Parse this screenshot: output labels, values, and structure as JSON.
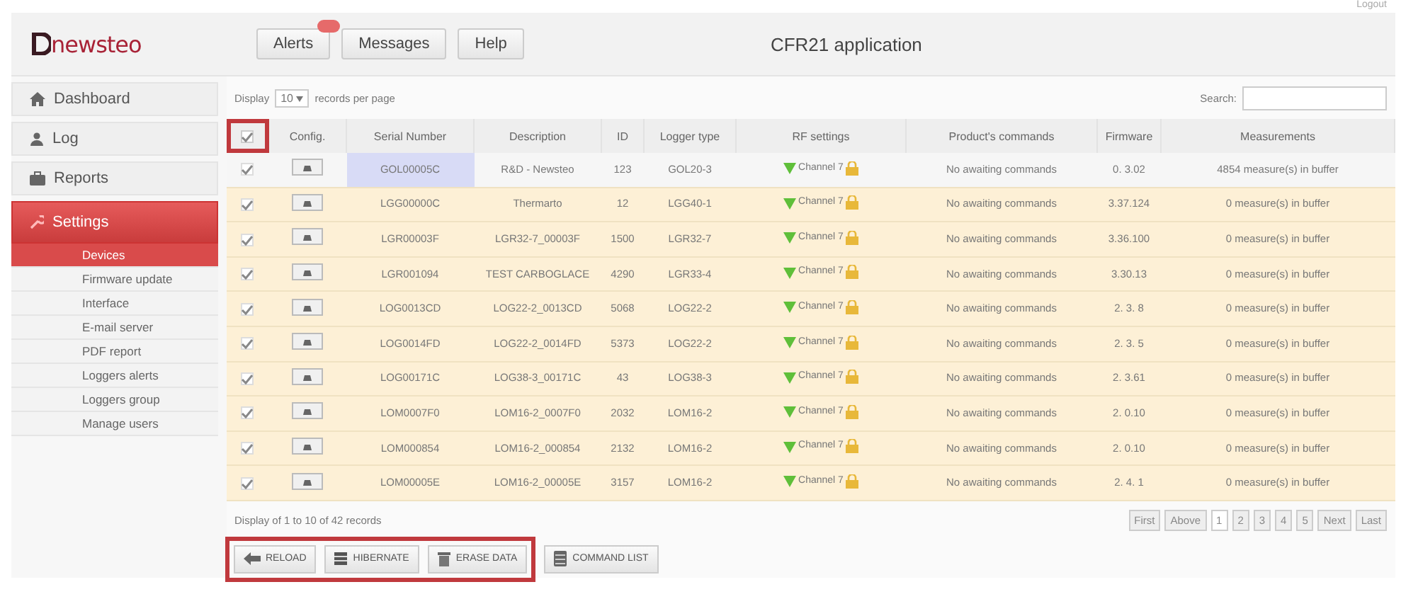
{
  "top_bar": {
    "logout": "Logout"
  },
  "logo": {
    "text": "newsteo"
  },
  "header": {
    "buttons": [
      {
        "label": "Alerts",
        "badge": true
      },
      {
        "label": "Messages",
        "badge": false
      },
      {
        "label": "Help",
        "badge": false
      }
    ],
    "title": "CFR21 application"
  },
  "sidebar": {
    "items": [
      {
        "label": "Dashboard",
        "selected": false
      },
      {
        "label": "Log",
        "selected": false
      },
      {
        "label": "Reports",
        "selected": false
      },
      {
        "label": "Settings",
        "selected": true,
        "children": [
          {
            "label": "Devices",
            "selected": true
          },
          {
            "label": "Firmware update",
            "selected": false
          },
          {
            "label": "Interface",
            "selected": false
          },
          {
            "label": "E-mail server",
            "selected": false
          },
          {
            "label": "PDF report",
            "selected": false
          },
          {
            "label": "Loggers alerts",
            "selected": false
          },
          {
            "label": "Loggers group",
            "selected": false
          },
          {
            "label": "Manage users",
            "selected": false
          }
        ]
      }
    ]
  },
  "table_controls": {
    "display_label": "Display",
    "page_size": "10",
    "page_size_suffix": "records per page",
    "search_label": "Search:"
  },
  "table": {
    "select_all": {
      "checked": true,
      "highlighted": true
    },
    "columns": [
      "Config.",
      "Serial Number",
      "Description",
      "ID",
      "Logger type",
      "RF settings",
      "Product's commands",
      "Firmware",
      "Measurements"
    ],
    "rows": [
      {
        "checked": true,
        "current": true,
        "serial": "GOL00005C",
        "description": "R&D - Newsteo",
        "id": "123",
        "logger_type": "GOL20-3",
        "rf": "Channel 7",
        "commands": "No awaiting commands",
        "firmware": "0. 3.02",
        "measurements": "4854 measure(s) in buffer"
      },
      {
        "checked": true,
        "current": false,
        "serial": "LGG00000C",
        "description": "Thermarto",
        "id": "12",
        "logger_type": "LGG40-1",
        "rf": "Channel 7",
        "commands": "No awaiting commands",
        "firmware": "3.37.124",
        "measurements": "0 measure(s) in buffer"
      },
      {
        "checked": true,
        "current": false,
        "serial": "LGR00003F",
        "description": "LGR32-7_00003F",
        "id": "1500",
        "logger_type": "LGR32-7",
        "rf": "Channel 7",
        "commands": "No awaiting commands",
        "firmware": "3.36.100",
        "measurements": "0 measure(s) in buffer"
      },
      {
        "checked": true,
        "current": false,
        "serial": "LGR001094",
        "description": "TEST CARBOGLACE",
        "id": "4290",
        "logger_type": "LGR33-4",
        "rf": "Channel 7",
        "commands": "No awaiting commands",
        "firmware": "3.30.13",
        "measurements": "0 measure(s) in buffer"
      },
      {
        "checked": true,
        "current": false,
        "serial": "LOG0013CD",
        "description": "LOG22-2_0013CD",
        "id": "5068",
        "logger_type": "LOG22-2",
        "rf": "Channel 7",
        "commands": "No awaiting commands",
        "firmware": "2. 3. 8",
        "measurements": "0 measure(s) in buffer"
      },
      {
        "checked": true,
        "current": false,
        "serial": "LOG0014FD",
        "description": "LOG22-2_0014FD",
        "id": "5373",
        "logger_type": "LOG22-2",
        "rf": "Channel 7",
        "commands": "No awaiting commands",
        "firmware": "2. 3. 5",
        "measurements": "0 measure(s) in buffer"
      },
      {
        "checked": true,
        "current": false,
        "serial": "LOG00171C",
        "description": "LOG38-3_00171C",
        "id": "43",
        "logger_type": "LOG38-3",
        "rf": "Channel 7",
        "commands": "No awaiting commands",
        "firmware": "2. 3.61",
        "measurements": "0 measure(s) in buffer"
      },
      {
        "checked": true,
        "current": false,
        "serial": "LOM0007F0",
        "description": "LOM16-2_0007F0",
        "id": "2032",
        "logger_type": "LOM16-2",
        "rf": "Channel 7",
        "commands": "No awaiting commands",
        "firmware": "2. 0.10",
        "measurements": "0 measure(s) in buffer"
      },
      {
        "checked": true,
        "current": false,
        "serial": "LOM000854",
        "description": "LOM16-2_000854",
        "id": "2132",
        "logger_type": "LOM16-2",
        "rf": "Channel 7",
        "commands": "No awaiting commands",
        "firmware": "2. 0.10",
        "measurements": "0 measure(s) in buffer"
      },
      {
        "checked": true,
        "current": false,
        "serial": "LOM00005E",
        "description": "LOM16-2_00005E",
        "id": "3157",
        "logger_type": "LOM16-2",
        "rf": "Channel 7",
        "commands": "No awaiting commands",
        "firmware": "2. 4. 1",
        "measurements": "0 measure(s) in buffer"
      }
    ]
  },
  "footer": {
    "info": "Display of 1 to 10 of 42 records",
    "pagination": [
      {
        "label": "First",
        "selected": false
      },
      {
        "label": "Above",
        "selected": false
      },
      {
        "label": "1",
        "selected": true
      },
      {
        "label": "2",
        "selected": false
      },
      {
        "label": "3",
        "selected": false
      },
      {
        "label": "4",
        "selected": false
      },
      {
        "label": "5",
        "selected": false
      },
      {
        "label": "Next",
        "selected": false
      },
      {
        "label": "Last",
        "selected": false
      }
    ]
  },
  "actions": {
    "buttons": [
      {
        "label": "RELOAD",
        "highlighted": true
      },
      {
        "label": "HIBERNATE",
        "highlighted": true
      },
      {
        "label": "ERASE DATA",
        "highlighted": true
      },
      {
        "label": "COMMAND LIST",
        "highlighted": false
      }
    ]
  }
}
